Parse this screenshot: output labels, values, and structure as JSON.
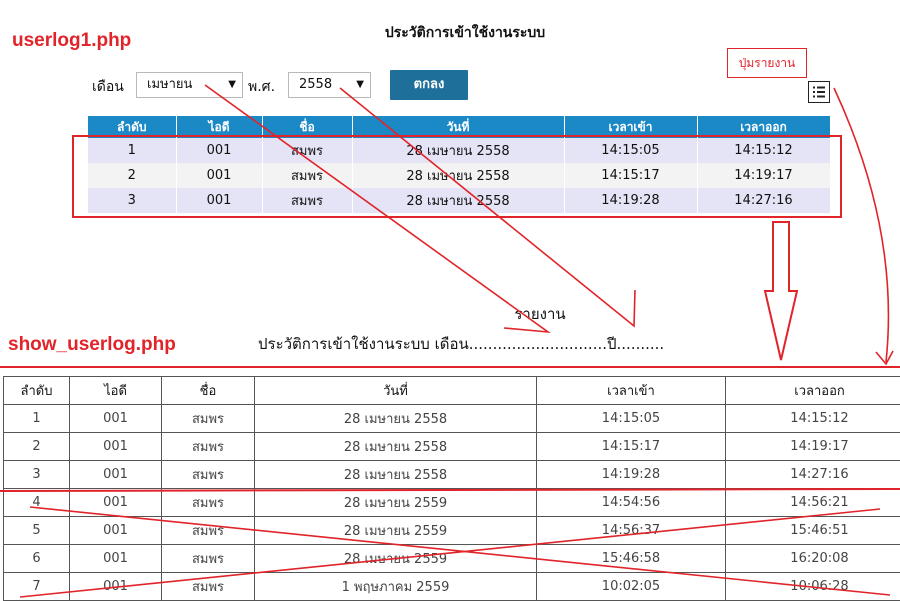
{
  "labels": {
    "userlog_file": "userlog1.php",
    "show_file": "show_userlog.php",
    "report_button_callout": "ปุ่มรายงาน"
  },
  "page_title": "ประวัติการเข้าใช้งานระบบ",
  "filter": {
    "month_label": "เดือน",
    "month_value": "เมษายน",
    "year_label": "พ.ศ.",
    "year_value": "2558",
    "submit_label": "ตกลง"
  },
  "report_icon": "list-icon",
  "top_table": {
    "headers": [
      "ลำดับ",
      "ไอดี",
      "ชื่อ",
      "วันที่",
      "เวลาเข้า",
      "เวลาออก"
    ],
    "rows": [
      [
        "1",
        "001",
        "สมพร",
        "28 เมษายน 2558",
        "14:15:05",
        "14:15:12"
      ],
      [
        "2",
        "001",
        "สมพร",
        "28 เมษายน 2558",
        "14:15:17",
        "14:19:17"
      ],
      [
        "3",
        "001",
        "สมพร",
        "28 เมษายน 2558",
        "14:19:28",
        "14:27:16"
      ]
    ]
  },
  "report": {
    "heading": "รายงาน",
    "subheading": "ประวัติการเข้าใช้งานระบบ เดือน.............................ปี.........."
  },
  "bottom_table": {
    "headers": [
      "ลำดับ",
      "ไอดี",
      "ชื่อ",
      "วันที่",
      "เวลาเข้า",
      "เวลาออก"
    ],
    "rows": [
      [
        "1",
        "001",
        "สมพร",
        "28 เมษายน 2558",
        "14:15:05",
        "14:15:12"
      ],
      [
        "2",
        "001",
        "สมพร",
        "28 เมษายน 2558",
        "14:15:17",
        "14:19:17"
      ],
      [
        "3",
        "001",
        "สมพร",
        "28 เมษายน 2558",
        "14:19:28",
        "14:27:16"
      ],
      [
        "4",
        "001",
        "สมพร",
        "28 เมษายน 2559",
        "14:54:56",
        "14:56:21"
      ],
      [
        "5",
        "001",
        "สมพร",
        "28 เมษายน 2559",
        "14:56:37",
        "15:46:51"
      ],
      [
        "6",
        "001",
        "สมพร",
        "28 เมษายน 2559",
        "15:46:58",
        "16:20:08"
      ],
      [
        "7",
        "001",
        "สมพร",
        "1 พฤษภาคม 2559",
        "10:02:05",
        "10:06:28"
      ]
    ]
  },
  "colors": {
    "annotation_red": "#e0242a",
    "table_header_blue": "#1a89c6",
    "button_blue": "#1f6f9b"
  }
}
